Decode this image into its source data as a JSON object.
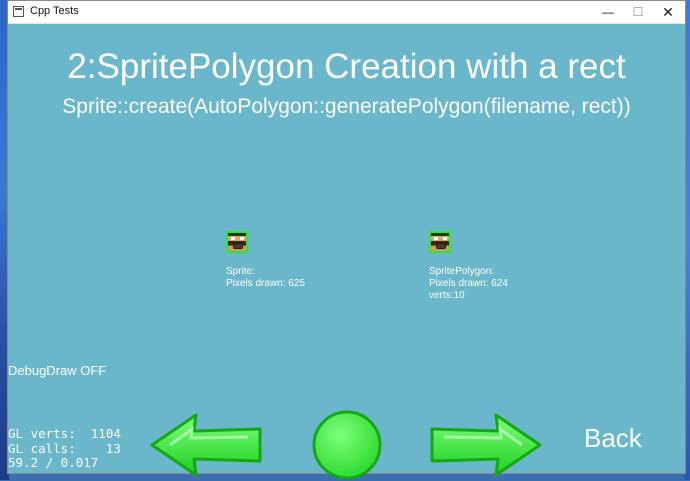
{
  "window": {
    "title": "Cpp Tests",
    "minimize_glyph": "—",
    "maximize_glyph": "☐",
    "close_glyph": "✕"
  },
  "scene": {
    "title": "2:SpritePolygon Creation with a rect",
    "subtitle": "Sprite::create(AutoPolygon::generatePolygon(filename, rect))",
    "sprite_left": {
      "line1": "Sprite:",
      "line2": "Pixels drawn: 625"
    },
    "sprite_right": {
      "line1": "SpritePolygon:",
      "line2": "Pixels drawn: 624",
      "line3": "verts:10"
    },
    "debug_draw": "DebugDraw OFF",
    "stats": {
      "line1": "GL verts:  1104",
      "line2": "GL calls:    13",
      "line3": "59.2 / 0.017"
    },
    "back_label": "Back"
  },
  "colors": {
    "background": "#6ab7cb",
    "arrow_green": "#45f045",
    "arrow_outline": "#1fb81f"
  },
  "icons": {
    "app": "app-window-icon",
    "prev": "left-arrow-icon",
    "restart": "circle-icon",
    "next": "right-arrow-icon"
  }
}
